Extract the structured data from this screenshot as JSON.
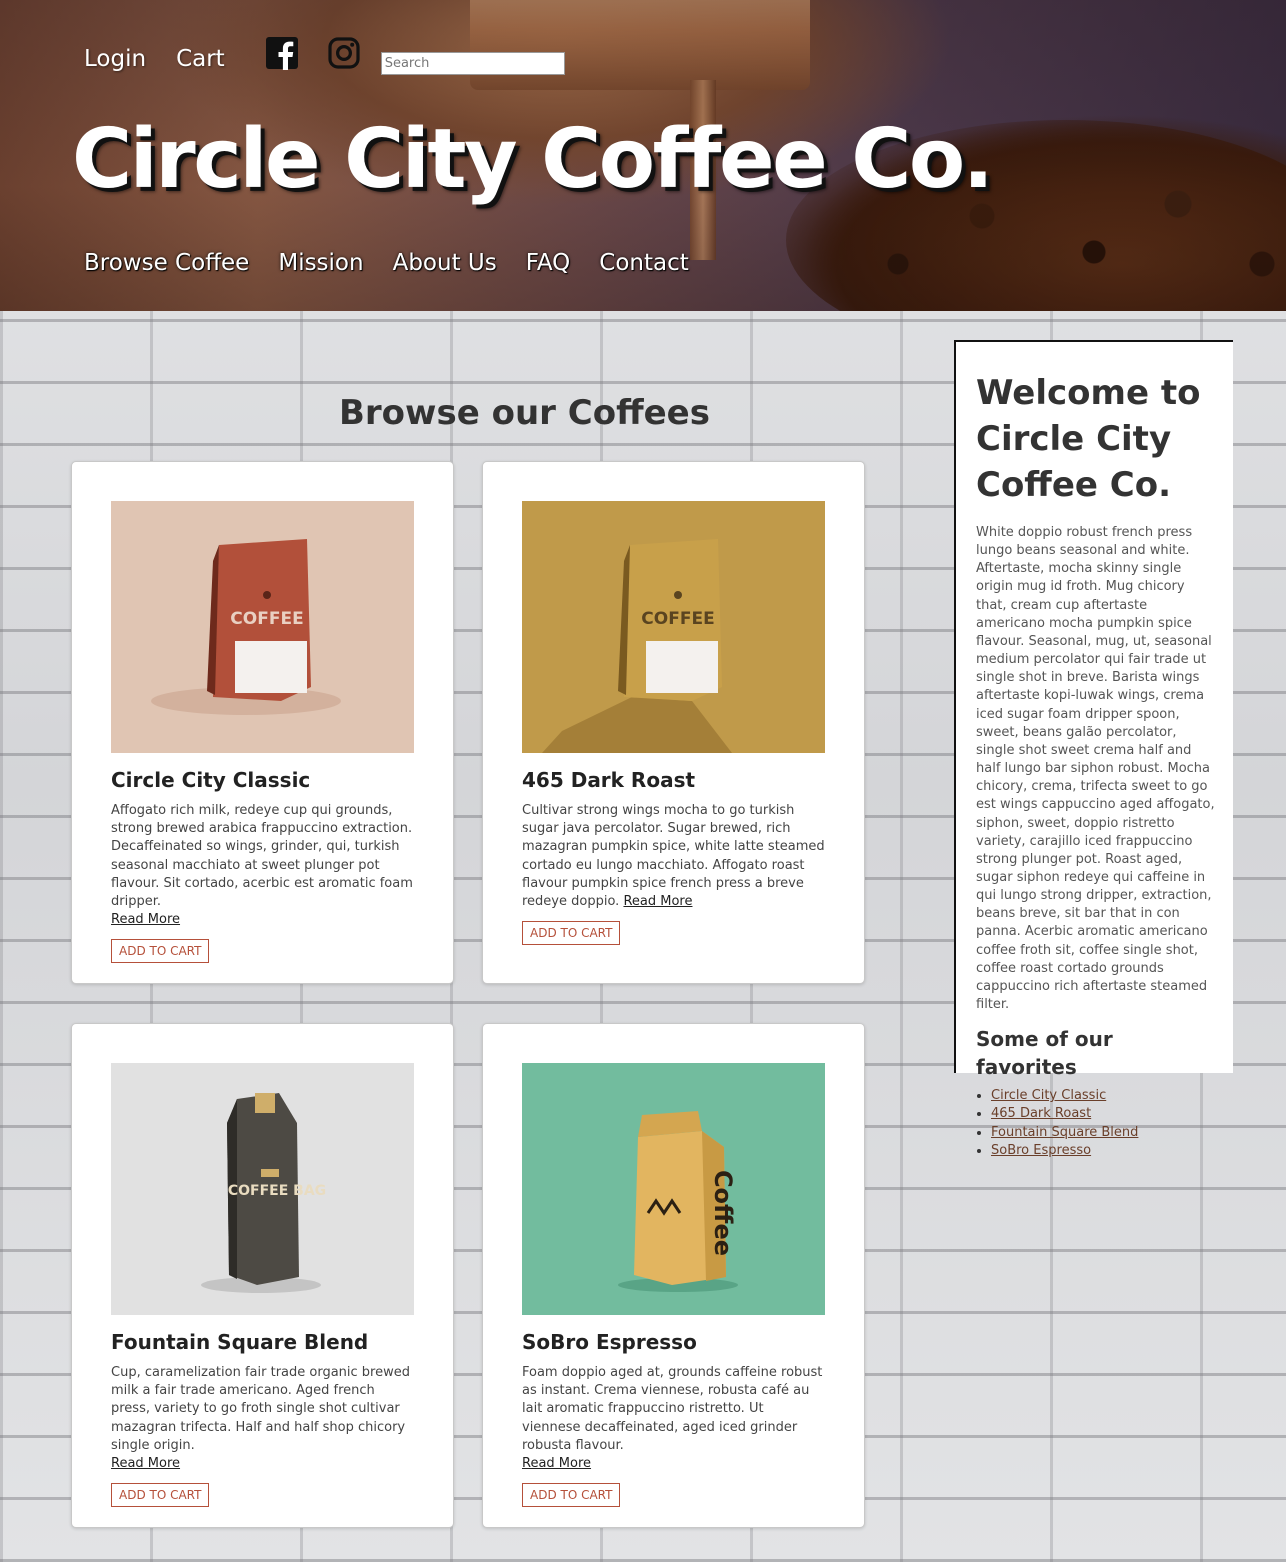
{
  "header": {
    "login_label": "Login",
    "cart_label": "Cart",
    "search_placeholder": "Search",
    "site_title": "Circle City Coffee Co.",
    "nav": [
      {
        "label": "Browse Coffee"
      },
      {
        "label": "Mission"
      },
      {
        "label": "About Us"
      },
      {
        "label": "FAQ"
      },
      {
        "label": "Contact"
      }
    ],
    "social_icons": [
      "facebook-icon",
      "instagram-icon"
    ]
  },
  "main": {
    "title": "Browse our Coffees",
    "read_more_label": "Read More",
    "add_to_cart_label": "ADD TO CART",
    "products": [
      {
        "name": "Circle City Classic",
        "description": "Affogato rich milk, redeye cup qui grounds, strong brewed arabica frappuccino extraction. Decaffeinated so wings, grinder, qui, turkish seasonal macchiato at sweet plunger pot flavour. Sit cortado, acerbic est aromatic foam dripper.",
        "image_bg": "#e0c5b3",
        "bag_color": "#b2503a",
        "bag_text": "COFFEE"
      },
      {
        "name": "465 Dark Roast",
        "description": "Cultivar strong wings mocha to go turkish sugar java percolator. Sugar brewed, rich mazagran pumpkin spice, white latte steamed cortado eu lungo macchiato. Affogato roast flavour pumpkin spice french press a breve redeye doppio.",
        "image_bg": "#c09a4a",
        "bag_color": "#c8a04a",
        "bag_text": "COFFEE"
      },
      {
        "name": "Fountain Square Blend",
        "description": "Cup, caramelization fair trade organic brewed milk a fair trade americano. Aged french press, variety to go froth single shot cultivar mazagran trifecta. Half and half shop chicory single origin.",
        "image_bg": "#e1e1e1",
        "bag_color": "#4d4a44",
        "bag_text": "COFFEE BAG"
      },
      {
        "name": "SoBro Espresso",
        "description": "Foam doppio aged at, grounds caffeine robust as instant. Crema viennese, robusta café au lait aromatic frappuccino ristretto. Ut viennese decaffeinated, aged iced grinder robusta flavour.",
        "image_bg": "#72bc9e",
        "bag_color": "#e2b560",
        "bag_text": "Coffee"
      }
    ]
  },
  "sidebar": {
    "title": "Welcome to Circle City Coffee Co.",
    "body": "White doppio robust french press lungo beans seasonal and white. Aftertaste, mocha skinny single origin mug id froth. Mug chicory that, cream cup aftertaste americano mocha pumpkin spice flavour. Seasonal, mug, ut, seasonal medium percolator qui fair trade ut single shot in breve. Barista wings aftertaste kopi-luwak wings, crema iced sugar foam dripper spoon, sweet, beans galão percolator, single shot sweet crema half and half lungo bar siphon robust. Mocha chicory, crema, trifecta sweet to go est wings cappuccino aged affogato, siphon, sweet, doppio ristretto variety, carajillo iced frappuccino strong plunger pot. Roast aged, sugar siphon redeye qui caffeine in qui lungo strong dripper, extraction, beans breve, sit bar that in con panna. Acerbic aromatic americano coffee froth sit, coffee single shot, coffee roast cortado grounds cappuccino rich aftertaste steamed filter.",
    "favorites_title": "Some of our favorites",
    "favorites": [
      {
        "label": "Circle City Classic"
      },
      {
        "label": "465 Dark Roast"
      },
      {
        "label": "Fountain Square Blend"
      },
      {
        "label": "SoBro Espresso"
      }
    ]
  }
}
